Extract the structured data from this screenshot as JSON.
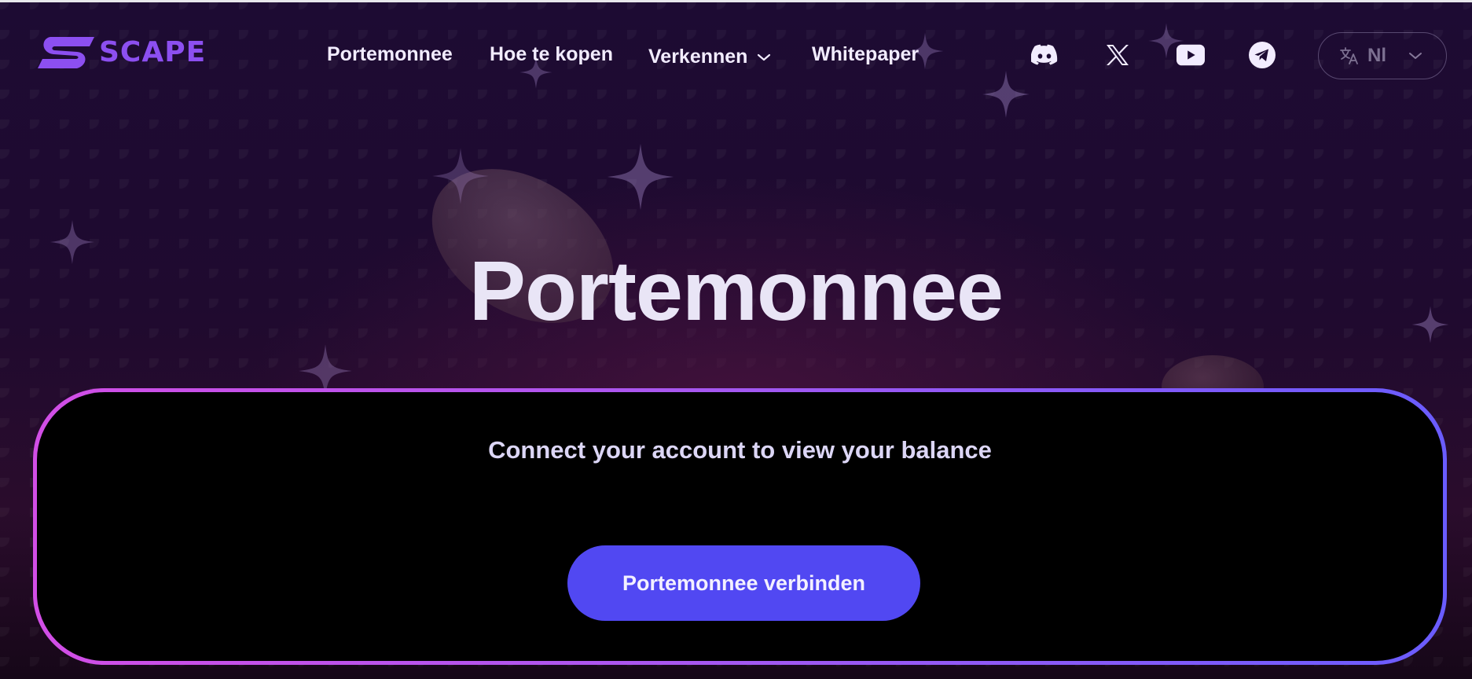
{
  "brand": {
    "logo_text": "SCAPE",
    "accent": "#8c4ff0"
  },
  "nav": {
    "items": [
      {
        "label": "Portemonnee"
      },
      {
        "label": "Hoe te kopen"
      },
      {
        "label": "Verkennen",
        "icon": "chevron-down-icon"
      },
      {
        "label": "Whitepaper"
      }
    ]
  },
  "social": [
    {
      "icon": "discord-icon"
    },
    {
      "icon": "x-icon"
    },
    {
      "icon": "youtube-icon"
    },
    {
      "icon": "telegram-icon"
    }
  ],
  "language": {
    "value": "Nl",
    "icon": "translate-icon"
  },
  "hero": {
    "title": "Portemonnee"
  },
  "wallet_card": {
    "message": "Connect your account to view your balance",
    "button_label": "Portemonnee verbinden",
    "button_color": "#5148f2"
  }
}
